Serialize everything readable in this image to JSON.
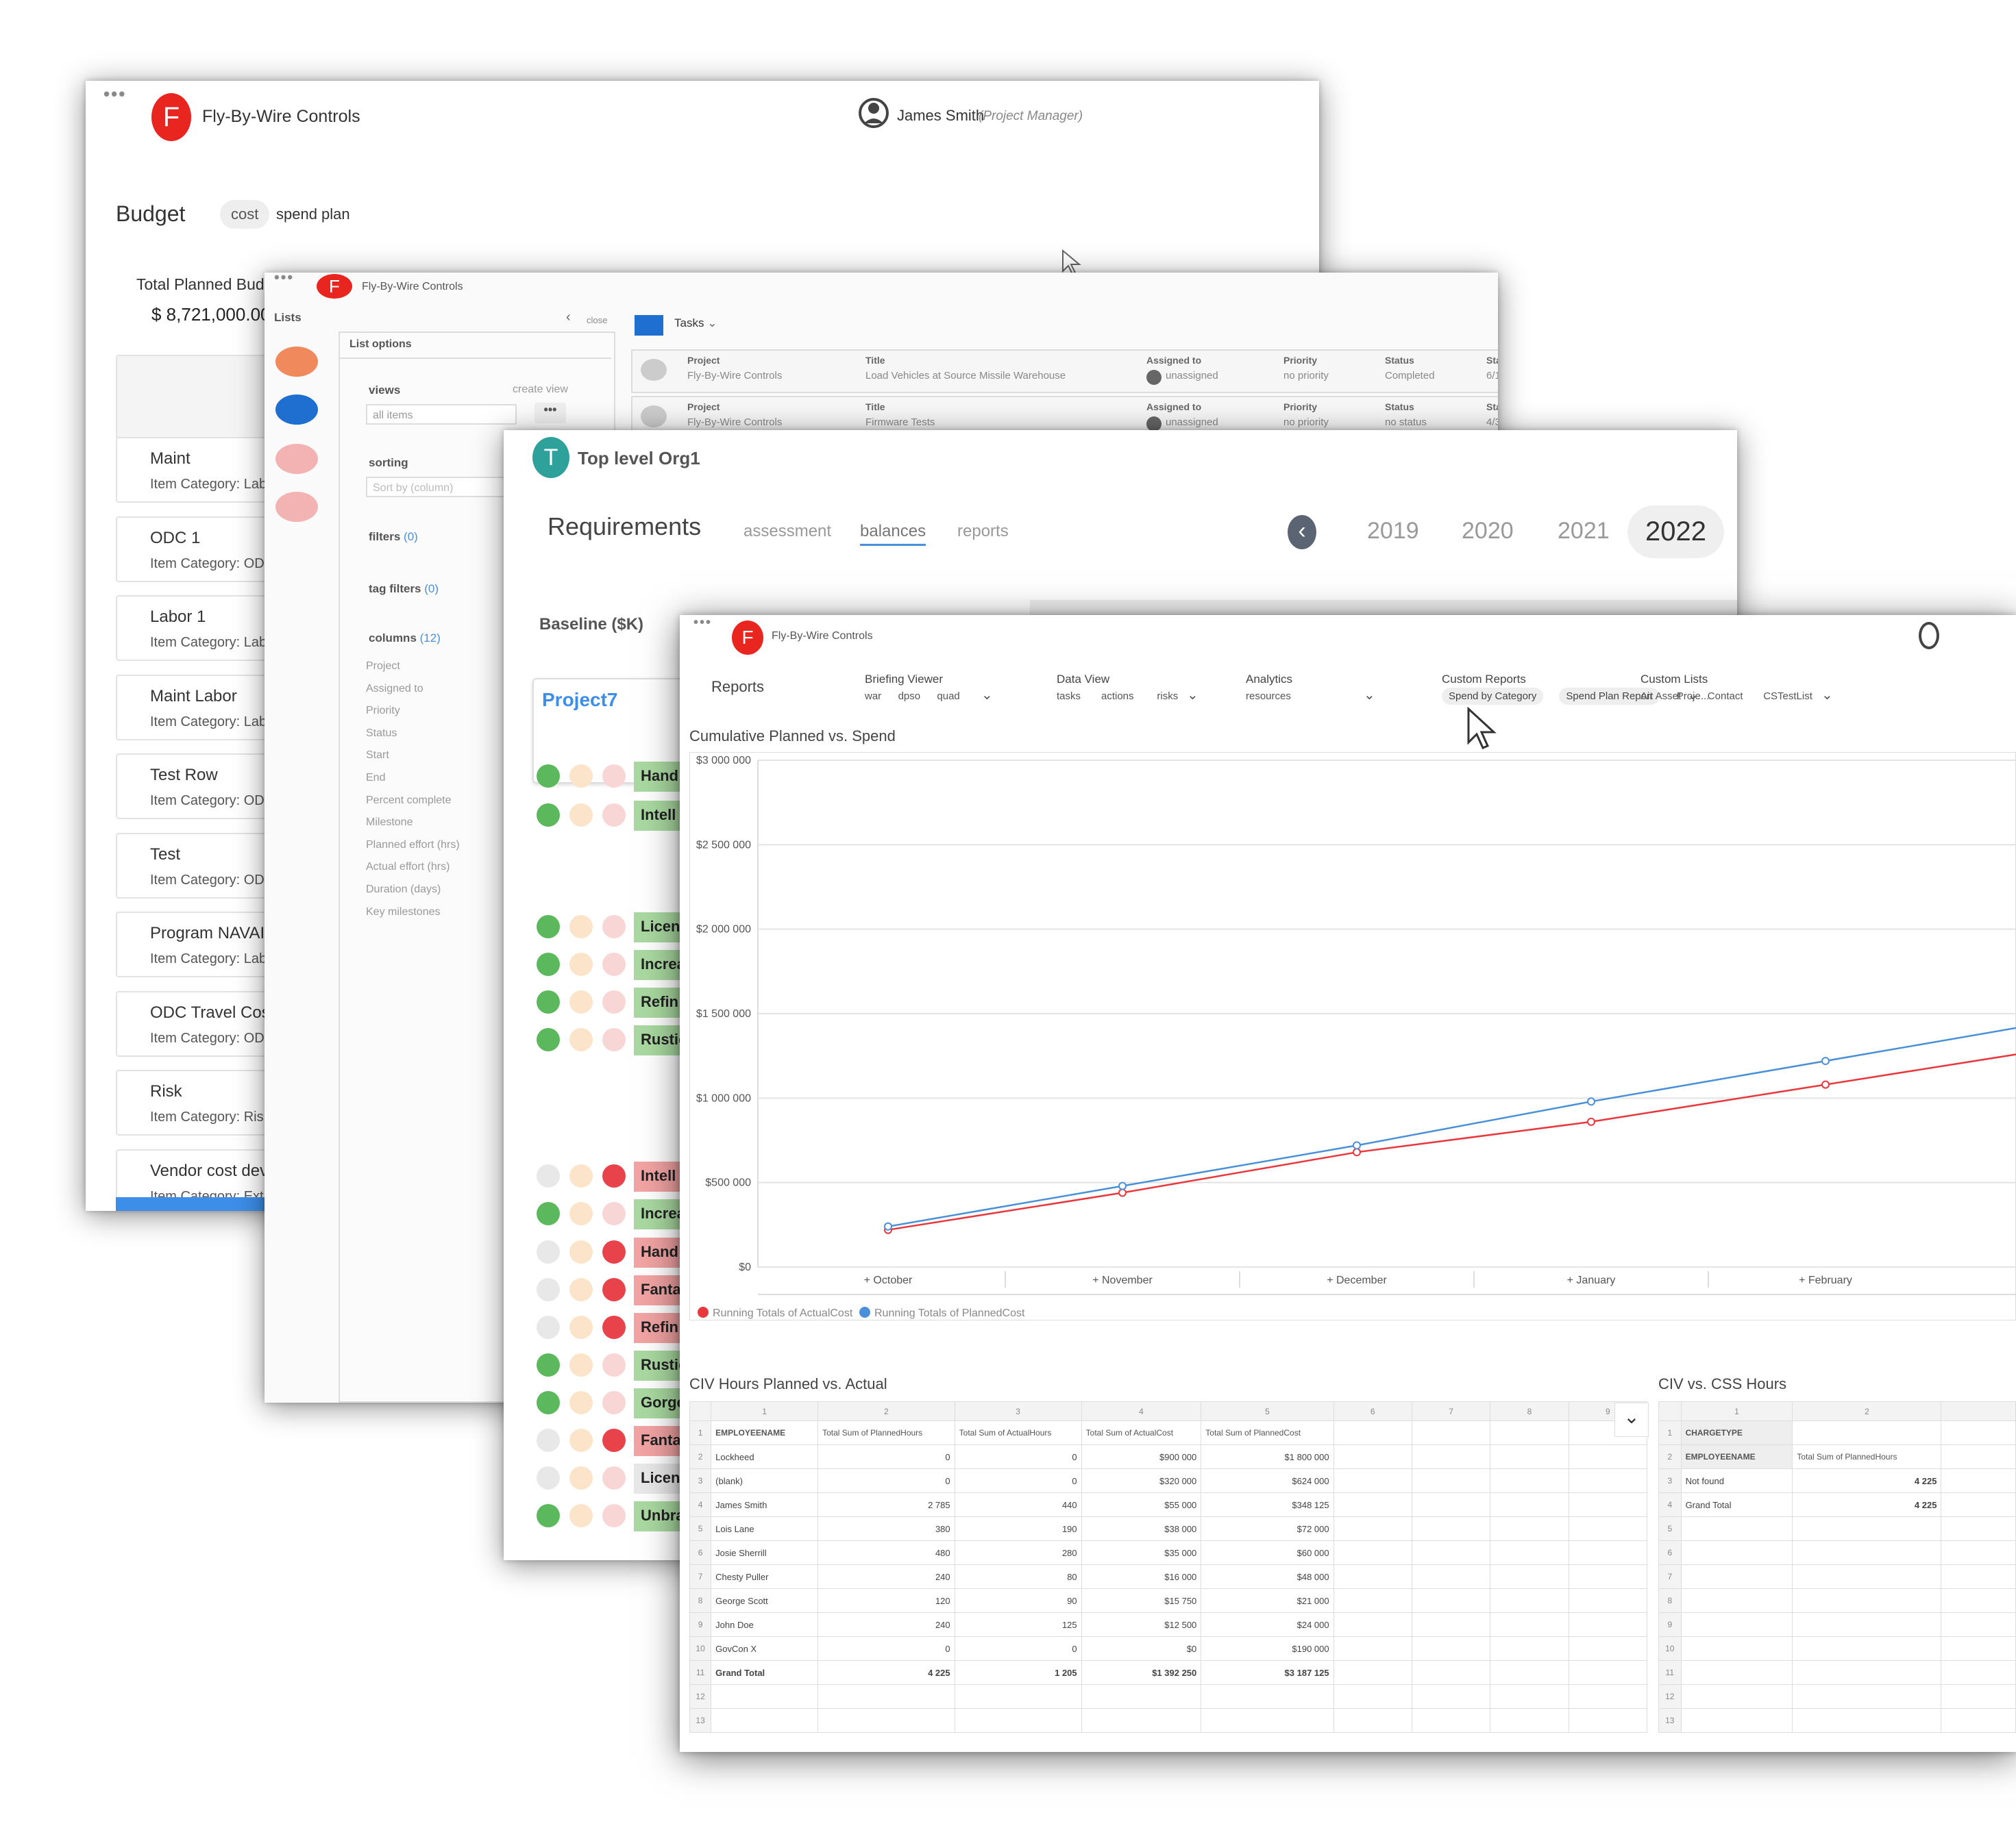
{
  "budget_window": {
    "org_name": "Fly-By-Wire Controls",
    "logo_letter": "F",
    "user_name": "James Smith",
    "user_role": "(Project Manager)",
    "title": "Budget",
    "tabs": [
      "cost",
      "spend plan"
    ],
    "total_label": "Total Planned Budge",
    "total_value": "$ 8,721,000.00",
    "items": [
      {
        "name": "Maint",
        "category": "Item Category: Lab"
      },
      {
        "name": "ODC 1",
        "category": "Item Category: OD"
      },
      {
        "name": "Labor 1",
        "category": "Item Category: Lab"
      },
      {
        "name": "Maint Labor",
        "category": "Item Category: Lab"
      },
      {
        "name": "Test Row",
        "category": "Item Category: OD"
      },
      {
        "name": "Test",
        "category": "Item Category: OD"
      },
      {
        "name": "Program NAVAIR",
        "category": "Item Category: Lab"
      },
      {
        "name": "ODC Travel Cost",
        "category": "Item Category: OD"
      },
      {
        "name": "Risk",
        "category": "Item Category: Risk"
      },
      {
        "name": "Vendor cost devel",
        "category": "Item Category: Ext"
      }
    ]
  },
  "lists_window": {
    "org_name": "Fly-By-Wire Controls",
    "logo_letter": "F",
    "lists_label": "Lists",
    "close_label": "close",
    "panel_title": "List options",
    "views_label": "views",
    "create_view": "create view",
    "views_value": "all items",
    "sorting_label": "sorting",
    "sort_placeholder": "Sort by (column)",
    "filters_label": "filters",
    "filters_count": "(0)",
    "tag_filters_label": "tag filters",
    "tag_filters_count": "(0)",
    "columns_label": "columns",
    "columns_count": "(12)",
    "columns": [
      "Project",
      "Assigned to",
      "Priority",
      "Status",
      "Start",
      "End",
      "Percent complete",
      "Milestone",
      "Planned effort (hrs)",
      "Actual effort (hrs)",
      "Duration (days)",
      "Key milestones"
    ],
    "tasks_label": "Tasks",
    "task_headers": {
      "project": "Project",
      "title": "Title",
      "assigned": "Assigned to",
      "priority": "Priority",
      "status": "Status",
      "start": "Sta"
    },
    "tasks": [
      {
        "project": "Fly-By-Wire Controls",
        "title": "Load Vehicles at Source Missile Warehouse",
        "assigned": "unassigned",
        "priority": "no priority",
        "status": "Completed",
        "start": "6/1"
      },
      {
        "project": "Fly-By-Wire Controls",
        "title": "Firmware Tests",
        "assigned": "unassigned",
        "priority": "no priority",
        "status": "no status",
        "start": "4/3"
      }
    ]
  },
  "requirements_window": {
    "org_name": "Top level Org1",
    "logo_letter": "T",
    "title": "Requirements",
    "tabs": [
      "assessment",
      "balances",
      "reports"
    ],
    "years": [
      "2019",
      "2020",
      "2021",
      "2022"
    ],
    "baseline_label": "Baseline ($K)",
    "project_name": "Project7",
    "rows": [
      {
        "label": "Hand",
        "tone": "green"
      },
      {
        "label": "Intell",
        "tone": "green"
      },
      {
        "label": "Licen",
        "tone": "green"
      },
      {
        "label": "Increa",
        "tone": "green"
      },
      {
        "label": "Refin",
        "tone": "green"
      },
      {
        "label": "Rustic",
        "tone": "green"
      },
      {
        "label": "Intell",
        "tone": "red"
      },
      {
        "label": "Increa",
        "tone": "green"
      },
      {
        "label": "Hand",
        "tone": "red"
      },
      {
        "label": "Fanta",
        "tone": "red"
      },
      {
        "label": "Refin",
        "tone": "red"
      },
      {
        "label": "Rustic",
        "tone": "green"
      },
      {
        "label": "Gorge",
        "tone": "green"
      },
      {
        "label": "Fanta",
        "tone": "red"
      },
      {
        "label": "Licen",
        "tone": "none"
      },
      {
        "label": "Unbra",
        "tone": "green"
      }
    ]
  },
  "reports_window": {
    "org_name": "Fly-By-Wire Controls",
    "logo_letter": "F",
    "reports_label": "Reports",
    "nav": [
      {
        "title": "Briefing Viewer",
        "items": [
          "war",
          "dpso",
          "quad"
        ]
      },
      {
        "title": "Data View",
        "items": [
          "tasks",
          "actions",
          "risks"
        ]
      },
      {
        "title": "Analytics",
        "items": [
          "resources"
        ]
      },
      {
        "title": "Custom Reports",
        "items": [
          "Spend by Category",
          "Spend Plan Report",
          "Proje..."
        ]
      },
      {
        "title": "Custom Lists",
        "items": [
          "Air Asset",
          "Contact",
          "CSTestList"
        ]
      }
    ],
    "chart_title": "Cumulative Planned vs. Spend",
    "table1_title": "CIV Hours Planned vs. Actual",
    "table2_title": "CIV vs. CSS Hours",
    "table1": {
      "col_numbers": [
        "1",
        "2",
        "3",
        "4",
        "5",
        "6",
        "7",
        "8",
        "9"
      ],
      "headers": [
        "EMPLOYEENAME",
        "Total Sum of PlannedHours",
        "Total Sum of ActualHours",
        "Total Sum of ActualCost",
        "Total Sum of PlannedCost"
      ],
      "rows": [
        [
          "Lockheed",
          "0",
          "0",
          "$900 000",
          "$1 800 000"
        ],
        [
          "(blank)",
          "0",
          "0",
          "$320 000",
          "$624 000"
        ],
        [
          "James Smith",
          "2 785",
          "440",
          "$55 000",
          "$348 125"
        ],
        [
          "Lois Lane",
          "380",
          "190",
          "$38 000",
          "$72 000"
        ],
        [
          "Josie Sherrill",
          "480",
          "280",
          "$35 000",
          "$60 000"
        ],
        [
          "Chesty Puller",
          "240",
          "80",
          "$16 000",
          "$48 000"
        ],
        [
          "George Scott",
          "120",
          "90",
          "$15 750",
          "$21 000"
        ],
        [
          "John Doe",
          "240",
          "125",
          "$12 500",
          "$24 000"
        ],
        [
          "GovCon X",
          "0",
          "0",
          "$0",
          "$190 000"
        ],
        [
          "Grand Total",
          "4 225",
          "1 205",
          "$1 392 250",
          "$3 187 125"
        ]
      ],
      "row_numbers": [
        "1",
        "2",
        "3",
        "4",
        "5",
        "6",
        "7",
        "8",
        "9",
        "10",
        "11",
        "12",
        "13"
      ]
    },
    "table2": {
      "col_numbers": [
        "1",
        "2"
      ],
      "headers": [
        "CHARGETYPE",
        "EMPLOYEENAME",
        "Total Sum of PlannedHours"
      ],
      "rows": [
        [
          "Not found",
          "4 225"
        ],
        [
          "Grand Total",
          "4 225"
        ]
      ],
      "row_numbers": [
        "1",
        "2",
        "3",
        "4",
        "5",
        "6",
        "7",
        "8",
        "9",
        "10",
        "11",
        "12",
        "13"
      ]
    }
  },
  "chart_data": {
    "type": "line",
    "title": "Cumulative Planned vs. Spend",
    "categories": [
      "October",
      "November",
      "December",
      "January",
      "February"
    ],
    "y_ticks": [
      "$0",
      "$500 000",
      "$1 000 000",
      "$1 500 000",
      "$2 000 000",
      "$2 500 000",
      "$3 000 000"
    ],
    "ylim": [
      0,
      3000000
    ],
    "grid": true,
    "legend_position": "bottom-left",
    "series": [
      {
        "name": "Running Totals of ActualCost",
        "color": "#e8383d",
        "values": [
          220000,
          440000,
          680000,
          860000,
          1080000
        ]
      },
      {
        "name": "Running Totals of PlannedCost",
        "color": "#4a90d9",
        "values": [
          240000,
          480000,
          720000,
          980000,
          1220000
        ]
      }
    ]
  }
}
